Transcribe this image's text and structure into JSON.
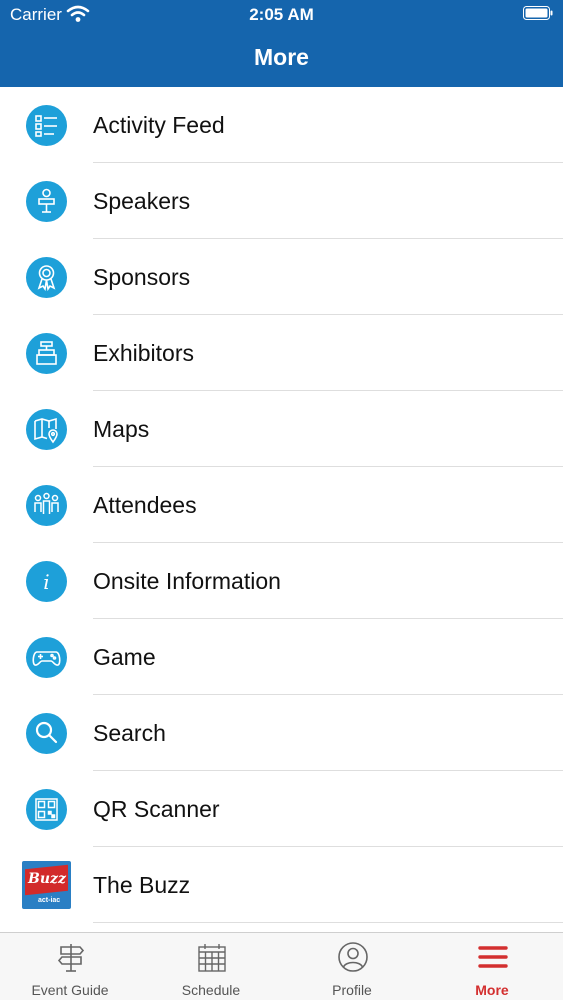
{
  "status_bar": {
    "carrier": "Carrier",
    "time": "2:05 AM"
  },
  "header": {
    "title": "More"
  },
  "menu": {
    "items": [
      {
        "label": "Activity Feed",
        "icon": "activity-feed-icon"
      },
      {
        "label": "Speakers",
        "icon": "speaker-icon"
      },
      {
        "label": "Sponsors",
        "icon": "award-ribbon-icon"
      },
      {
        "label": "Exhibitors",
        "icon": "exhibitor-booth-icon"
      },
      {
        "label": "Maps",
        "icon": "map-pin-icon"
      },
      {
        "label": "Attendees",
        "icon": "people-icon"
      },
      {
        "label": "Onsite Information",
        "icon": "info-icon"
      },
      {
        "label": "Game",
        "icon": "gamepad-icon"
      },
      {
        "label": "Search",
        "icon": "search-icon"
      },
      {
        "label": "QR Scanner",
        "icon": "qr-code-icon"
      },
      {
        "label": "The Buzz",
        "icon": "buzz-logo",
        "logo_text": "Buzz",
        "logo_sub": "act-iac"
      }
    ]
  },
  "tabbar": {
    "tabs": [
      {
        "label": "Event Guide",
        "icon": "signpost-icon",
        "active": false
      },
      {
        "label": "Schedule",
        "icon": "calendar-icon",
        "active": false
      },
      {
        "label": "Profile",
        "icon": "profile-icon",
        "active": false
      },
      {
        "label": "More",
        "icon": "menu-icon",
        "active": true
      }
    ]
  },
  "colors": {
    "header_bg": "#1565ad",
    "icon_bg": "#1ea0d9",
    "active_tab": "#d32f2f",
    "inactive_tab": "#555555"
  }
}
